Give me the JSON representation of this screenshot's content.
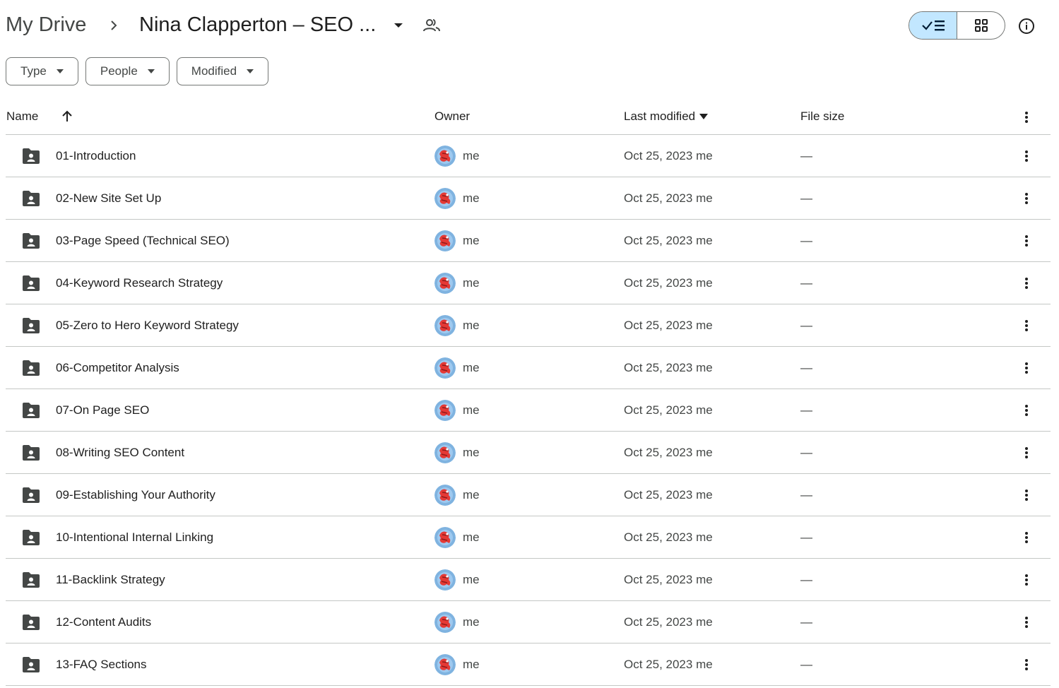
{
  "breadcrumb": {
    "root": "My Drive",
    "current": "Nina Clapperton – SEO ..."
  },
  "filters": [
    {
      "label": "Type"
    },
    {
      "label": "People"
    },
    {
      "label": "Modified"
    }
  ],
  "columns": {
    "name": "Name",
    "owner": "Owner",
    "last_modified": "Last modified",
    "file_size": "File size"
  },
  "rows": [
    {
      "name": "01-Introduction",
      "owner": "me",
      "modified": "Oct 25, 2023 me",
      "size": "—"
    },
    {
      "name": "02-New Site Set Up",
      "owner": "me",
      "modified": "Oct 25, 2023 me",
      "size": "—"
    },
    {
      "name": "03-Page Speed (Technical SEO)",
      "owner": "me",
      "modified": "Oct 25, 2023 me",
      "size": "—"
    },
    {
      "name": "04-Keyword Research Strategy",
      "owner": "me",
      "modified": "Oct 25, 2023 me",
      "size": "—"
    },
    {
      "name": "05-Zero to Hero Keyword Strategy",
      "owner": "me",
      "modified": "Oct 25, 2023 me",
      "size": "—"
    },
    {
      "name": "06-Competitor Analysis",
      "owner": "me",
      "modified": "Oct 25, 2023 me",
      "size": "—"
    },
    {
      "name": "07-On Page SEO",
      "owner": "me",
      "modified": "Oct 25, 2023 me",
      "size": "—"
    },
    {
      "name": "08-Writing SEO Content",
      "owner": "me",
      "modified": "Oct 25, 2023 me",
      "size": "—"
    },
    {
      "name": "09-Establishing Your Authority",
      "owner": "me",
      "modified": "Oct 25, 2023 me",
      "size": "—"
    },
    {
      "name": "10-Intentional Internal Linking",
      "owner": "me",
      "modified": "Oct 25, 2023 me",
      "size": "—"
    },
    {
      "name": "11-Backlink Strategy",
      "owner": "me",
      "modified": "Oct 25, 2023 me",
      "size": "—"
    },
    {
      "name": "12-Content Audits",
      "owner": "me",
      "modified": "Oct 25, 2023 me",
      "size": "—"
    },
    {
      "name": "13-FAQ Sections",
      "owner": "me",
      "modified": "Oct 25, 2023 me",
      "size": "—"
    }
  ],
  "icons": {
    "breadcrumb_separator": "chevron-right-icon",
    "breadcrumb_menu": "caret-down-icon",
    "shared": "people-icon",
    "list_view": "check-list-icon",
    "grid_view": "grid-icon",
    "info": "info-icon",
    "folder": "shared-folder-icon",
    "sort": "arrow-up-icon",
    "more": "more-vert-icon"
  },
  "colors": {
    "selected_toggle": "#c2e7ff",
    "text_primary": "#1f1f1f",
    "text_secondary": "#444746",
    "divider": "#c4c7c5"
  }
}
